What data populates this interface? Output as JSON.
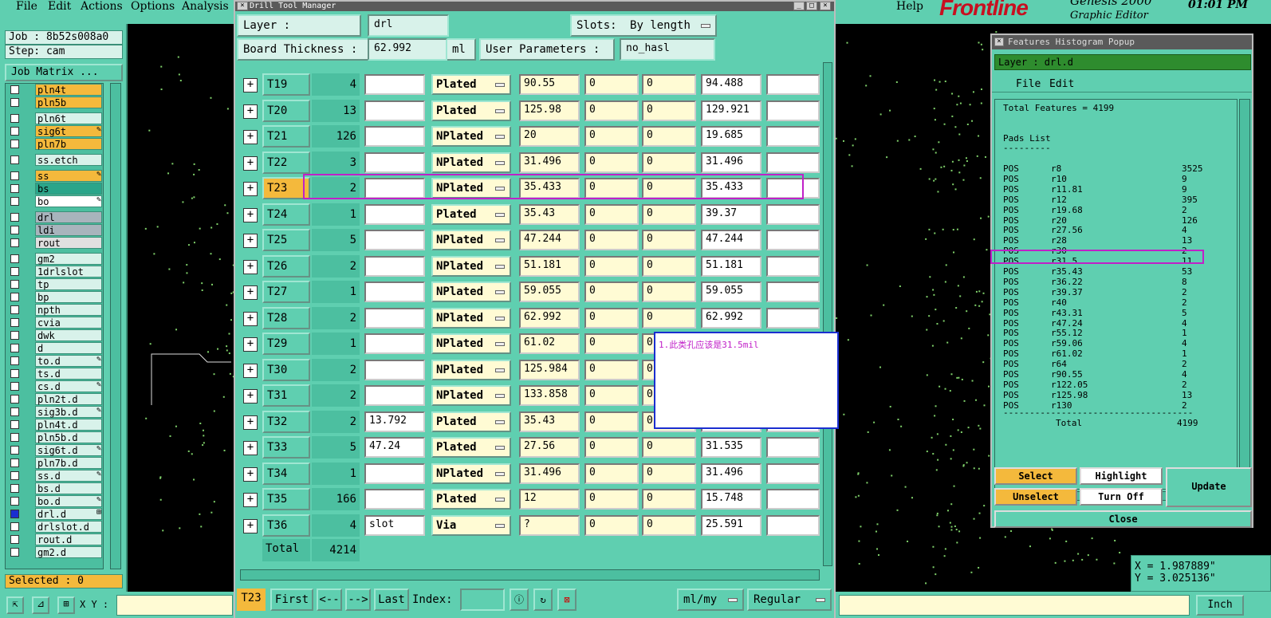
{
  "menubar": {
    "items": [
      "File",
      "Edit",
      "Actions",
      "Options",
      "Analysis"
    ],
    "help": "Help",
    "brand": "Frontline",
    "product_partial": "Genesis 2000",
    "product_sub": "Graphic Editor",
    "clock": "01:01 PM"
  },
  "left": {
    "job": "Job : 8b52s008a0",
    "step": "Step: cam",
    "job_matrix": "Job Matrix ...",
    "selected": "Selected : 0",
    "layers": [
      {
        "name": "pln4t",
        "color": "#f4b93c",
        "mark": ""
      },
      {
        "name": "pln5b",
        "color": "#f4b93c",
        "mark": ""
      },
      {
        "name": "pln6t",
        "color": "#d8f2ea",
        "mark": ""
      },
      {
        "name": "sig6t",
        "color": "#f4b93c",
        "mark": "✎"
      },
      {
        "name": "pln7b",
        "color": "#f4b93c",
        "mark": ""
      },
      {
        "name": "ss.etch",
        "color": "#d8f2ea",
        "mark": ""
      },
      {
        "name": "ss",
        "color": "#f4b93c",
        "mark": "✎"
      },
      {
        "name": "bs",
        "color": "#2aa58a",
        "mark": ""
      },
      {
        "name": "bo",
        "color": "#ffffff",
        "mark": "✎"
      },
      {
        "name": "drl",
        "color": "#a8b4bc",
        "mark": ""
      },
      {
        "name": "ldi",
        "color": "#a8b4bc",
        "mark": ""
      },
      {
        "name": "rout",
        "color": "#e0e0e0",
        "mark": ""
      },
      {
        "name": "gm2",
        "color": "#d8f2ea",
        "mark": ""
      },
      {
        "name": "1drlslot",
        "color": "#d8f2ea",
        "mark": ""
      },
      {
        "name": "tp",
        "color": "#d8f2ea",
        "mark": ""
      },
      {
        "name": "bp",
        "color": "#d8f2ea",
        "mark": ""
      },
      {
        "name": "npth",
        "color": "#d8f2ea",
        "mark": ""
      },
      {
        "name": "cvia",
        "color": "#d8f2ea",
        "mark": ""
      },
      {
        "name": "dwk",
        "color": "#d8f2ea",
        "mark": ""
      },
      {
        "name": "d",
        "color": "#d8f2ea",
        "mark": ""
      },
      {
        "name": "to.d",
        "color": "#d8f2ea",
        "mark": "✎"
      },
      {
        "name": "ts.d",
        "color": "#d8f2ea",
        "mark": ""
      },
      {
        "name": "cs.d",
        "color": "#d8f2ea",
        "mark": "✎"
      },
      {
        "name": "pln2t.d",
        "color": "#d8f2ea",
        "mark": ""
      },
      {
        "name": "sig3b.d",
        "color": "#d8f2ea",
        "mark": "✎"
      },
      {
        "name": "pln4t.d",
        "color": "#d8f2ea",
        "mark": ""
      },
      {
        "name": "pln5b.d",
        "color": "#d8f2ea",
        "mark": ""
      },
      {
        "name": "sig6t.d",
        "color": "#d8f2ea",
        "mark": "✎"
      },
      {
        "name": "pln7b.d",
        "color": "#d8f2ea",
        "mark": ""
      },
      {
        "name": "ss.d",
        "color": "#d8f2ea",
        "mark": "✎"
      },
      {
        "name": "bs.d",
        "color": "#d8f2ea",
        "mark": ""
      },
      {
        "name": "bo.d",
        "color": "#d8f2ea",
        "mark": "✎"
      },
      {
        "name": "drl.d",
        "color": "#d8f2ea",
        "mark": "⊞"
      },
      {
        "name": "drlslot.d",
        "color": "#d8f2ea",
        "mark": ""
      },
      {
        "name": "rout.d",
        "color": "#d8f2ea",
        "mark": ""
      },
      {
        "name": "gm2.d",
        "color": "#d8f2ea",
        "mark": ""
      }
    ]
  },
  "dtm": {
    "title": "Drill Tool Manager",
    "layer_label": "Layer      :",
    "layer_value": "drl",
    "slots_label": "Slots:",
    "slots_value": "By length",
    "thickness_label": "Board Thickness :",
    "thickness_value": "62.992",
    "thickness_unit": "ml",
    "user_params_label": "User Parameters :",
    "user_params_value": "no_hasl",
    "rows": [
      {
        "tool": "T19",
        "count": "4",
        "type": "",
        "plating": "Plated",
        "finish": "90.55",
        "tol_p": "0",
        "tol_m": "0",
        "drill": "94.488",
        "last": ""
      },
      {
        "tool": "T20",
        "count": "13",
        "type": "",
        "plating": "Plated",
        "finish": "125.98",
        "tol_p": "0",
        "tol_m": "0",
        "drill": "129.921",
        "last": ""
      },
      {
        "tool": "T21",
        "count": "126",
        "type": "",
        "plating": "NPlated",
        "finish": "20",
        "tol_p": "0",
        "tol_m": "0",
        "drill": "19.685",
        "last": ""
      },
      {
        "tool": "T22",
        "count": "3",
        "type": "",
        "plating": "NPlated",
        "finish": "31.496",
        "tol_p": "0",
        "tol_m": "0",
        "drill": "31.496",
        "last": ""
      },
      {
        "tool": "T23",
        "count": "2",
        "type": "",
        "plating": "NPlated",
        "finish": "35.433",
        "tol_p": "0",
        "tol_m": "0",
        "drill": "35.433",
        "last": ""
      },
      {
        "tool": "T24",
        "count": "1",
        "type": "",
        "plating": "Plated",
        "finish": "35.43",
        "tol_p": "0",
        "tol_m": "0",
        "drill": "39.37",
        "last": ""
      },
      {
        "tool": "T25",
        "count": "5",
        "type": "",
        "plating": "NPlated",
        "finish": "47.244",
        "tol_p": "0",
        "tol_m": "0",
        "drill": "47.244",
        "last": ""
      },
      {
        "tool": "T26",
        "count": "2",
        "type": "",
        "plating": "NPlated",
        "finish": "51.181",
        "tol_p": "0",
        "tol_m": "0",
        "drill": "51.181",
        "last": ""
      },
      {
        "tool": "T27",
        "count": "1",
        "type": "",
        "plating": "NPlated",
        "finish": "59.055",
        "tol_p": "0",
        "tol_m": "0",
        "drill": "59.055",
        "last": ""
      },
      {
        "tool": "T28",
        "count": "2",
        "type": "",
        "plating": "NPlated",
        "finish": "62.992",
        "tol_p": "0",
        "tol_m": "0",
        "drill": "62.992",
        "last": ""
      },
      {
        "tool": "T29",
        "count": "1",
        "type": "",
        "plating": "NPlated",
        "finish": "61.02",
        "tol_p": "0",
        "tol_m": "0",
        "drill": "",
        "last": ""
      },
      {
        "tool": "T30",
        "count": "2",
        "type": "",
        "plating": "NPlated",
        "finish": "125.984",
        "tol_p": "0",
        "tol_m": "0",
        "drill": "",
        "last": ""
      },
      {
        "tool": "T31",
        "count": "2",
        "type": "",
        "plating": "NPlated",
        "finish": "133.858",
        "tol_p": "0",
        "tol_m": "0",
        "drill": "",
        "last": ""
      },
      {
        "tool": "T32",
        "count": "2",
        "type": "13.792",
        "plating": "Plated",
        "finish": "35.43",
        "tol_p": "0",
        "tol_m": "0",
        "drill": "",
        "last": ""
      },
      {
        "tool": "T33",
        "count": "5",
        "type": "47.24",
        "plating": "Plated",
        "finish": "27.56",
        "tol_p": "0",
        "tol_m": "0",
        "drill": "31.535",
        "last": ""
      },
      {
        "tool": "T34",
        "count": "1",
        "type": "",
        "plating": "NPlated",
        "finish": "31.496",
        "tol_p": "0",
        "tol_m": "0",
        "drill": "31.496",
        "last": ""
      },
      {
        "tool": "T35",
        "count": "166",
        "type": "",
        "plating": "Plated",
        "finish": "12",
        "tol_p": "0",
        "tol_m": "0",
        "drill": "15.748",
        "last": ""
      },
      {
        "tool": "T36",
        "count": "4",
        "type": "slot",
        "plating": "Via",
        "finish": "?",
        "tol_p": "0",
        "tol_m": "0",
        "drill": "25.591",
        "last": ""
      }
    ],
    "total_label": "Total",
    "total_value": "4214",
    "nav": {
      "current": "T23",
      "first": "First",
      "prev": "<--",
      "next": "-->",
      "last": "Last",
      "index_label": "Index:",
      "units": "ml/my",
      "mode": "Regular"
    }
  },
  "note": {
    "text": "1.此类孔应该是31.5mil"
  },
  "histogram": {
    "title": "Features Histogram Popup",
    "layer": "Layer :  drl.d",
    "menu": [
      "File",
      "Edit"
    ],
    "total_features": "Total Features = 4199",
    "pads_list": "Pads List",
    "dashes": "---------",
    "rows": [
      {
        "pol": "POS",
        "sym": "r8",
        "cnt": "3525"
      },
      {
        "pol": "POS",
        "sym": "r10",
        "cnt": "9"
      },
      {
        "pol": "POS",
        "sym": "r11.81",
        "cnt": "9"
      },
      {
        "pol": "POS",
        "sym": "r12",
        "cnt": "395"
      },
      {
        "pol": "POS",
        "sym": "r19.68",
        "cnt": "2"
      },
      {
        "pol": "POS",
        "sym": "r20",
        "cnt": "126"
      },
      {
        "pol": "POS",
        "sym": "r27.56",
        "cnt": "4"
      },
      {
        "pol": "POS",
        "sym": "r28",
        "cnt": "13"
      },
      {
        "pol": "POS",
        "sym": "r30",
        "cnt": "2"
      },
      {
        "pol": "POS",
        "sym": "r31.5",
        "cnt": "11"
      },
      {
        "pol": "POS",
        "sym": "r35.43",
        "cnt": "53"
      },
      {
        "pol": "POS",
        "sym": "r36.22",
        "cnt": "8"
      },
      {
        "pol": "POS",
        "sym": "r39.37",
        "cnt": "2"
      },
      {
        "pol": "POS",
        "sym": "r40",
        "cnt": "2"
      },
      {
        "pol": "POS",
        "sym": "r43.31",
        "cnt": "5"
      },
      {
        "pol": "POS",
        "sym": "r47.24",
        "cnt": "4"
      },
      {
        "pol": "POS",
        "sym": "r55.12",
        "cnt": "1"
      },
      {
        "pol": "POS",
        "sym": "r59.06",
        "cnt": "4"
      },
      {
        "pol": "POS",
        "sym": "r61.02",
        "cnt": "1"
      },
      {
        "pol": "POS",
        "sym": "r64",
        "cnt": "2"
      },
      {
        "pol": "POS",
        "sym": "r90.55",
        "cnt": "4"
      },
      {
        "pol": "POS",
        "sym": "r122.05",
        "cnt": "2"
      },
      {
        "pol": "POS",
        "sym": "r125.98",
        "cnt": "13"
      },
      {
        "pol": "POS",
        "sym": "r130",
        "cnt": "2"
      }
    ],
    "total_line": "------------------------------------",
    "total_label": "Total",
    "total_value": "4199",
    "buttons": {
      "select": "Select",
      "highlight": "Highlight",
      "update": "Update",
      "unselect": "Unselect",
      "turn_off": "Turn Off",
      "close": "Close"
    }
  },
  "coords": {
    "x": "X = 1.987889\"",
    "y": "Y = 3.025136\""
  },
  "bottom": {
    "xy_label": "X Y :",
    "units": "Inch"
  },
  "colors": {
    "panel": "#5fcfb0",
    "highlight_box": "#c020c8",
    "note_border": "#1a2ed0",
    "selected_tool": "#f4b93c"
  }
}
